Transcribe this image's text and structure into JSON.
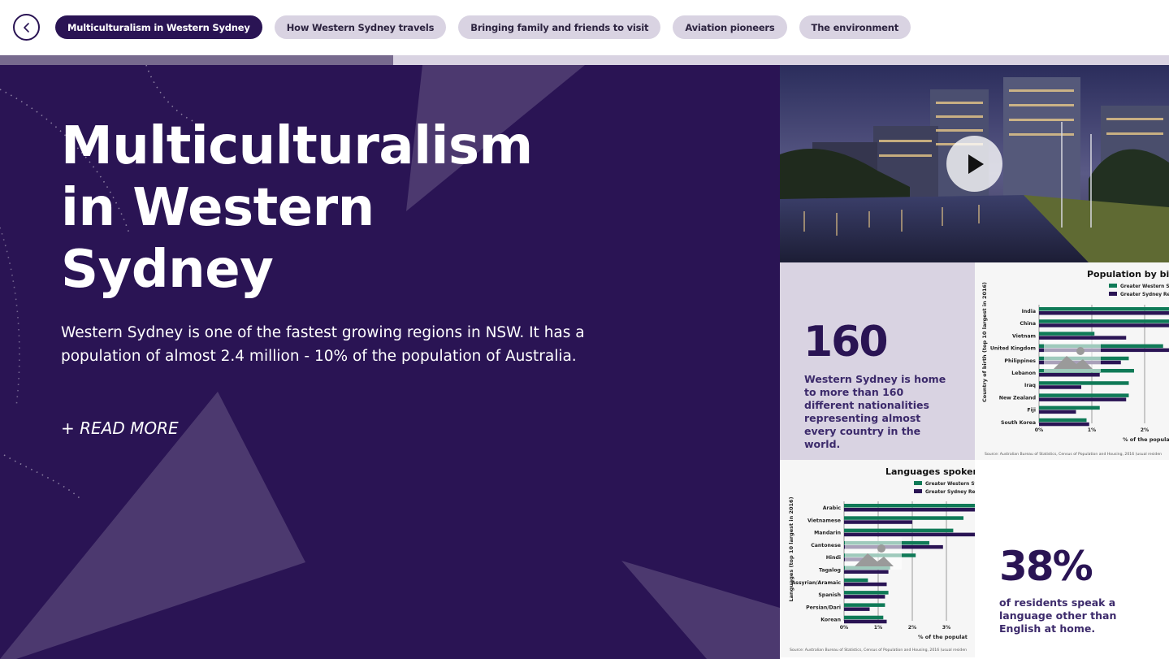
{
  "nav": {
    "back_icon": "chevron-left-icon",
    "tabs": [
      {
        "label": "Multiculturalism in Western Sydney",
        "active": true
      },
      {
        "label": "How Western Sydney travels",
        "active": false
      },
      {
        "label": "Bringing family and friends to visit",
        "active": false
      },
      {
        "label": "Aviation pioneers",
        "active": false
      },
      {
        "label": "The environment",
        "active": false
      }
    ]
  },
  "progress": {
    "value": 0.336
  },
  "hero": {
    "title_lines": [
      "Multiculturalism",
      "in Western",
      "Sydney"
    ],
    "text": "Western Sydney is one of the fastest growing regions in NSW. It has a population of almost 2.4 million - 10% of the population of Australia.",
    "read_more": "+ READ MORE"
  },
  "video": {
    "play_icon": "play-icon"
  },
  "stats": [
    {
      "number": "160",
      "text": "Western Sydney is home to more than 160 different nationalities representing almost every country in the world."
    },
    {
      "number": "38%",
      "text": "of residents speak a language other than English at home."
    }
  ],
  "colors": {
    "primary": "#2a1454",
    "pill": "#d9d3e2",
    "green": "#0f7a57",
    "purple_bar": "#2a1454"
  },
  "chart_data": [
    {
      "type": "bar",
      "title": "Population by birth",
      "ylabel": "Country of birth (top 10 largest in 2016)",
      "xlabel": "% of the popula",
      "x_ticks": [
        "0%",
        "1%",
        "2%"
      ],
      "xlim": [
        0,
        2.5
      ],
      "legend": [
        "Greater Western Sy",
        "Greater Sydney Reg"
      ],
      "categories": [
        "India",
        "China",
        "Vietnam",
        "United Kingdom",
        "Philippines",
        "Lebanon",
        "Iraq",
        "New Zealand",
        "Fiji",
        "South Korea"
      ],
      "series": [
        {
          "name": "Greater Western Sy",
          "values": [
            2.6,
            2.5,
            1.05,
            2.35,
            1.7,
            1.8,
            1.7,
            1.7,
            1.15,
            0.9
          ]
        },
        {
          "name": "Greater Sydney Reg",
          "values": [
            2.5,
            2.6,
            1.65,
            2.6,
            1.55,
            1.15,
            0.8,
            1.65,
            0.7,
            0.95
          ]
        }
      ],
      "source": "Source: Australian Bureau of Statistics, Census of Population and Housing, 2016 (usual residen"
    },
    {
      "type": "bar",
      "title": "Languages spoken at",
      "ylabel": "Languages (top 10 largest in 2016)",
      "xlabel": "% of the populat",
      "x_ticks": [
        "0%",
        "1%",
        "2%",
        "3%"
      ],
      "xlim": [
        0,
        4
      ],
      "legend": [
        "Greater Western Sy",
        "Greater Sydney Reg"
      ],
      "categories": [
        "Arabic",
        "Vietnamese",
        "Mandarin",
        "Cantonese",
        "Hindi",
        "Tagalog",
        "Assyrian/Aramaic",
        "Spanish",
        "Persian/Dari",
        "Korean"
      ],
      "series": [
        {
          "name": "Greater Western Sy",
          "values": [
            4.2,
            3.5,
            3.2,
            2.5,
            2.1,
            1.35,
            0.7,
            1.3,
            1.2,
            1.15
          ]
        },
        {
          "name": "Greater Sydney Reg",
          "values": [
            4.0,
            2.0,
            4.0,
            2.9,
            0.85,
            1.3,
            1.25,
            1.2,
            0.75,
            1.25
          ]
        }
      ],
      "source": "Source: Australian Bureau of Statistics, Census of Population and Housing, 2016 (usual residen"
    }
  ]
}
